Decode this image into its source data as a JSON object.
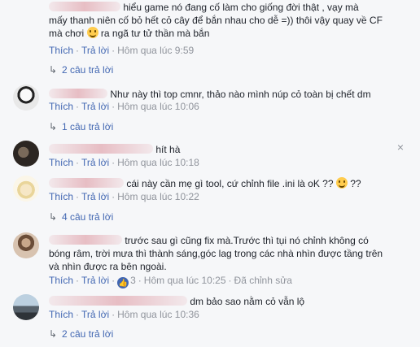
{
  "comments": [
    {
      "text_lines": [
        "hiểu game nó đang cố làm cho giống đời thật , vạy mà",
        "mấy thanh niên cố bỏ hết cỏ cây để bắn nhau cho dễ =)) thôi vậy quay về CF",
        "mà chơi",
        "ra ngã tư tử thần mà bắn"
      ],
      "like_label": "Thích",
      "reply_label": "Trả lời",
      "time": "Hôm qua lúc 9:59",
      "replies_label": "2 câu trả lời"
    },
    {
      "text": "Như này thì top cmnr, thảo nào mình núp cỏ toàn bị chết dm",
      "like_label": "Thích",
      "reply_label": "Trả lời",
      "time": "Hôm qua lúc 10:06",
      "replies_label": "1 câu trả lời"
    },
    {
      "text": "hít hà",
      "like_label": "Thích",
      "reply_label": "Trả lời",
      "time": "Hôm qua lúc 10:18",
      "close_icon": "×"
    },
    {
      "text": "cái này cần mẹ gì tool, cứ chỉnh file .ini là oK ??",
      "text_tail": "??",
      "like_label": "Thích",
      "reply_label": "Trả lời",
      "time": "Hôm qua lúc 10:22",
      "replies_label": "4 câu trả lời"
    },
    {
      "text_lines": [
        "trước sau gì cũng fix mà.Trước thì tụi nó chỉnh không có",
        "bóng râm, trời mưa thì thành sáng,góc lag trong các nhà nhìn được tầng trên",
        "và nhìn được ra bên ngoài."
      ],
      "like_label": "Thích",
      "reply_label": "Trả lời",
      "like_icon": "👍",
      "like_count": "3",
      "time": "Hôm qua lúc 10:25",
      "edited_label": "Đã chỉnh sửa"
    },
    {
      "text": "dm bảo sao nằm cỏ vẫn lộ",
      "like_label": "Thích",
      "reply_label": "Trả lời",
      "time": "Hôm qua lúc 10:36",
      "replies_label": "2 câu trả lời"
    }
  ],
  "reply_arrow": "↳",
  "colors": {
    "link": "#4267b2",
    "meta": "#90949c",
    "text": "#1d2129",
    "background": "#f6f7f9"
  }
}
